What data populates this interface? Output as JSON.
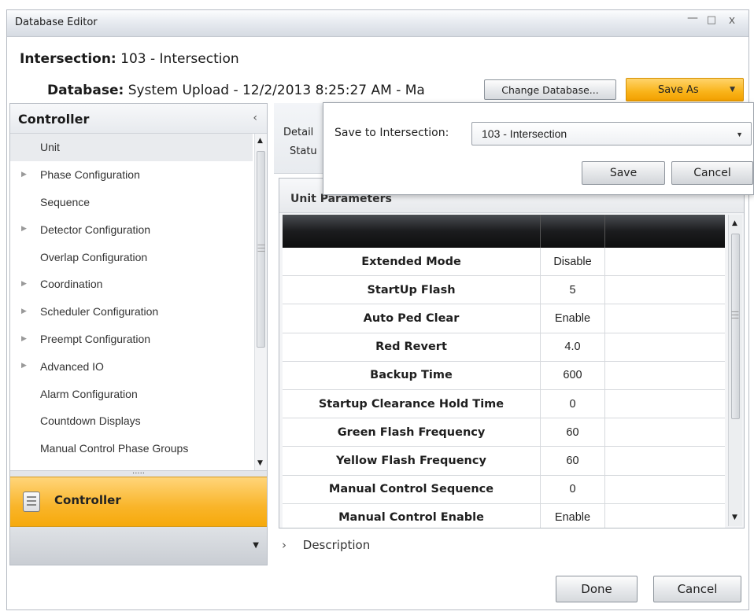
{
  "window": {
    "title": "Database Editor",
    "minimize": "—",
    "maximize": "□",
    "close": "x"
  },
  "header": {
    "intersection_label": "Intersection:",
    "intersection_value": "103 - Intersection",
    "database_label": "Database:",
    "database_value": "System Upload - 12/2/2013 8:25:27 AM - Ma",
    "change_database": "Change Database...",
    "save_as": "Save As",
    "save_as_arrow": "▼"
  },
  "sidebar": {
    "title": "Controller",
    "collapse_glyph": "‹",
    "items": [
      {
        "label": "Unit",
        "expandable": false,
        "selected": true
      },
      {
        "label": "Phase Configuration",
        "expandable": true,
        "selected": false
      },
      {
        "label": "Sequence",
        "expandable": false,
        "selected": false
      },
      {
        "label": "Detector Configuration",
        "expandable": true,
        "selected": false
      },
      {
        "label": "Overlap Configuration",
        "expandable": false,
        "selected": false
      },
      {
        "label": "Coordination",
        "expandable": true,
        "selected": false
      },
      {
        "label": "Scheduler Configuration",
        "expandable": true,
        "selected": false
      },
      {
        "label": "Preempt Configuration",
        "expandable": true,
        "selected": false
      },
      {
        "label": "Advanced IO",
        "expandable": true,
        "selected": false
      },
      {
        "label": "Alarm Configuration",
        "expandable": false,
        "selected": false
      },
      {
        "label": "Countdown Displays",
        "expandable": false,
        "selected": false
      },
      {
        "label": "Manual Control Phase Groups",
        "expandable": false,
        "selected": false
      }
    ],
    "active_section": "Controller",
    "splitter_glyph": "....."
  },
  "main": {
    "details_tab": "Detail",
    "status_tab": "Statu",
    "grid_title": "Unit Parameters",
    "rows": [
      {
        "name": "Extended Mode",
        "value": "Disable"
      },
      {
        "name": "StartUp Flash",
        "value": "5"
      },
      {
        "name": "Auto Ped Clear",
        "value": "Enable"
      },
      {
        "name": "Red Revert",
        "value": "4.0"
      },
      {
        "name": "Backup Time",
        "value": "600"
      },
      {
        "name": "Startup Clearance Hold Time",
        "value": "0"
      },
      {
        "name": "Green Flash Frequency",
        "value": "60"
      },
      {
        "name": "Yellow Flash Frequency",
        "value": "60"
      },
      {
        "name": "Manual Control Sequence",
        "value": "0"
      },
      {
        "name": "Manual Control Enable",
        "value": "Enable"
      }
    ],
    "description_chevron": "›",
    "description_label": "Description",
    "done_button": "Done",
    "cancel_button": "Cancel"
  },
  "popup": {
    "label": "Save to Intersection:",
    "selected": "103 - Intersection",
    "save_button": "Save",
    "cancel_button": "Cancel"
  },
  "colors": {
    "accent_orange": "#f9b319",
    "header_dark": "#1b1c1e",
    "selection": "#e9ebee"
  }
}
